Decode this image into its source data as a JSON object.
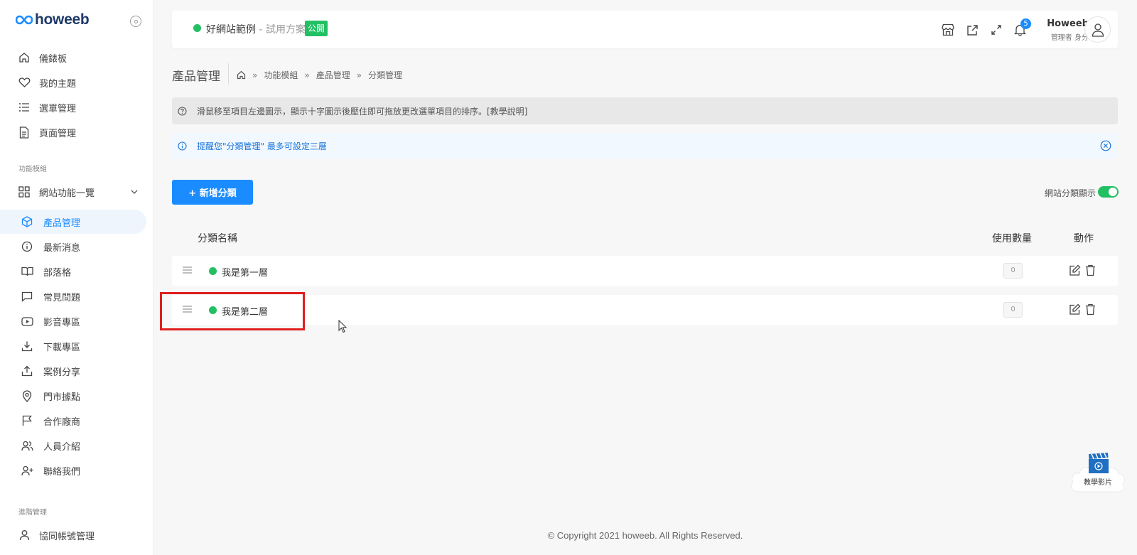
{
  "brand": {
    "logo_text": "howeeb",
    "accent": "#1a8cff",
    "success": "#22c063"
  },
  "sidebar": {
    "main_items": [
      {
        "label": "儀錶板",
        "icon": "home-icon"
      },
      {
        "label": "我的主題",
        "icon": "heart-icon"
      },
      {
        "label": "選單管理",
        "icon": "list-icon"
      },
      {
        "label": "頁面管理",
        "icon": "document-icon"
      }
    ],
    "section_modules": "功能模組",
    "modules_group": {
      "label": "網站功能一覽",
      "icon": "grid-icon"
    },
    "module_items": [
      {
        "label": "產品管理",
        "icon": "box-icon",
        "active": true
      },
      {
        "label": "最新消息",
        "icon": "info-icon"
      },
      {
        "label": "部落格",
        "icon": "book-icon"
      },
      {
        "label": "常見問題",
        "icon": "chat-icon"
      },
      {
        "label": "影音專區",
        "icon": "video-icon"
      },
      {
        "label": "下載專區",
        "icon": "download-icon"
      },
      {
        "label": "案例分享",
        "icon": "share-icon"
      },
      {
        "label": "門市據點",
        "icon": "map-pin-icon"
      },
      {
        "label": "合作廠商",
        "icon": "flag-icon"
      },
      {
        "label": "人員介紹",
        "icon": "users-icon"
      },
      {
        "label": "聯絡我們",
        "icon": "user-plus-icon"
      }
    ],
    "section_advanced": "進階管理",
    "advanced_items": [
      {
        "label": "協同帳號管理",
        "icon": "user-icon"
      }
    ]
  },
  "topbar": {
    "site_name": "好網站範例",
    "site_plan": " - 試用方案",
    "public_badge": "公開",
    "notification_count": "5",
    "user_name": "Howeeb",
    "user_role": "管理者 身分"
  },
  "page": {
    "title": "產品管理",
    "breadcrumb": [
      "功能模組",
      "產品管理",
      "分類管理"
    ],
    "breadcrumb_separator": "»"
  },
  "alerts": {
    "tip": "滑鼠移至項目左邊圖示，顯示十字圖示後壓住即可拖放更改選單項目的排序。[教學說明]",
    "reminder": "提醒您\"分類管理\" 最多可設定三層"
  },
  "actions": {
    "add_button": "+ 新增分類",
    "toggle_label": "網站分類顯示",
    "toggle_on": true
  },
  "table": {
    "headers": {
      "name": "分類名稱",
      "count": "使用數量",
      "actions": "動作"
    },
    "rows": [
      {
        "name": "我是第一層",
        "count": "0",
        "status": "visible"
      },
      {
        "name": "我是第二層",
        "count": "0",
        "status": "visible"
      }
    ]
  },
  "footer": {
    "copyright": "© Copyright 2021 howeeb. All Rights Reserved."
  },
  "video_widget": {
    "label": "教學影片"
  }
}
